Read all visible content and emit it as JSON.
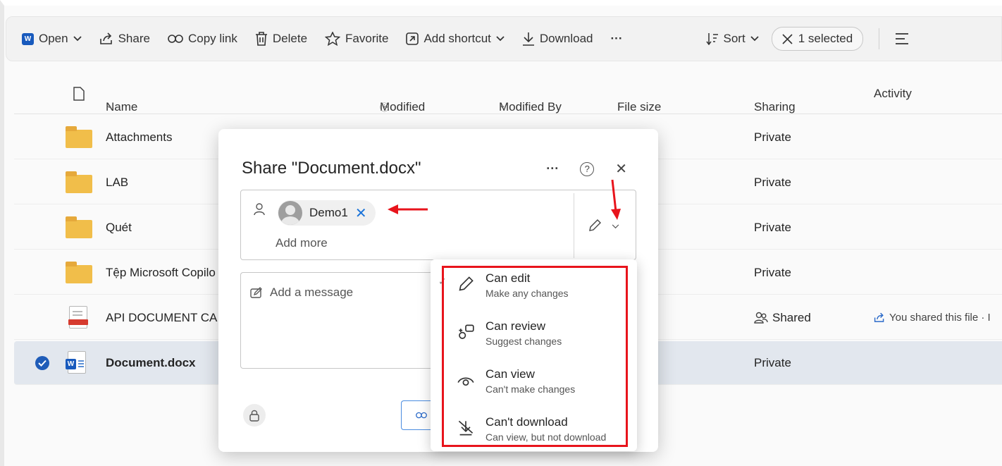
{
  "toolbar": {
    "open": "Open",
    "share": "Share",
    "copy_link": "Copy link",
    "delete": "Delete",
    "favorite": "Favorite",
    "add_shortcut": "Add shortcut",
    "download": "Download",
    "more": "···",
    "sort": "Sort",
    "selected": "1 selected"
  },
  "columns": {
    "name": "Name",
    "modified": "Modified",
    "modified_by": "Modified By",
    "file_size": "File size",
    "sharing": "Sharing",
    "activity": "Activity"
  },
  "rows": [
    {
      "name": "Attachments",
      "sharing": "Private",
      "activity": ""
    },
    {
      "name": "LAB",
      "sharing": "Private",
      "activity": ""
    },
    {
      "name": "Quét",
      "sharing": "Private",
      "activity": ""
    },
    {
      "name": "Tệp Microsoft Copilo",
      "sharing": "Private",
      "activity": ""
    },
    {
      "name": "API DOCUMENT CA",
      "sharing": "Shared",
      "activity": "You shared this file · I"
    },
    {
      "name": "Document.docx",
      "sharing": "Private",
      "activity": ""
    }
  ],
  "dialog": {
    "title": "Share \"Document.docx\"",
    "more": "···",
    "help": "?",
    "close": "✕",
    "recipient": "Demo1",
    "add_more": "Add more",
    "message_placeholder": "Add a message"
  },
  "permissions": [
    {
      "title": "Can edit",
      "subtitle": "Make any changes"
    },
    {
      "title": "Can review",
      "subtitle": "Suggest changes"
    },
    {
      "title": "Can view",
      "subtitle": "Can't make changes"
    },
    {
      "title": "Can't download",
      "subtitle": "Can view, but not download"
    }
  ],
  "colors": {
    "accent": "#1a73d9",
    "highlight": "#e8141c",
    "folder": "#f1be4a",
    "selected_row": "#e2e7ee"
  }
}
